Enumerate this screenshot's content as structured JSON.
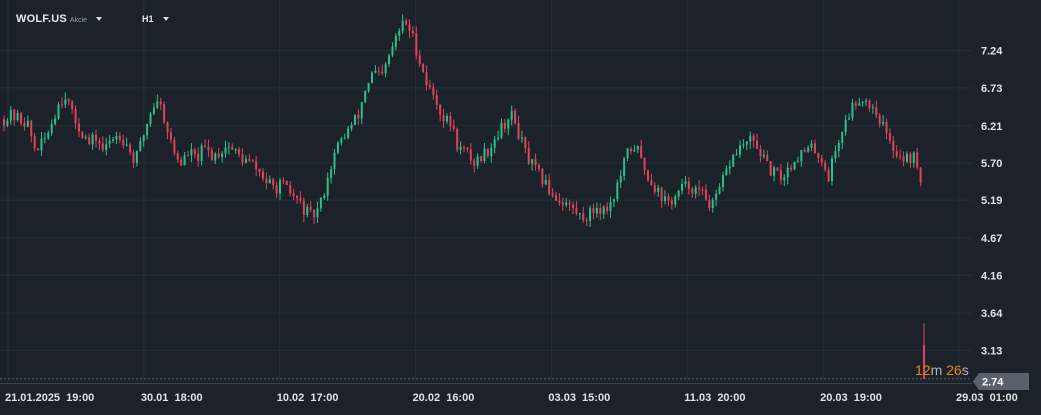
{
  "toolbar": {
    "symbol": "WOLF.US",
    "instrument_type": "Akcie",
    "timeframe": "H1"
  },
  "countdown": {
    "minutes": "12",
    "minutes_unit": "m",
    "seconds": "26",
    "seconds_unit": "s"
  },
  "current_price": "2.74",
  "colors": {
    "background": "#1b222a",
    "grid": "#262e38",
    "up": "#2ec08a",
    "down": "#e0435a",
    "axis_text": "#dfe3e8",
    "badge": "#59626c",
    "countdown": "#e08a1e"
  },
  "chart_data": {
    "type": "candlestick",
    "title": "",
    "xlabel": "",
    "ylabel": "",
    "ylim": [
      2.6,
      7.88
    ],
    "y_ticks": [
      "7.24",
      "6.73",
      "6.21",
      "5.70",
      "5.19",
      "4.67",
      "4.16",
      "3.64",
      "3.13"
    ],
    "x_tick_labels": [
      "21.01.2025  19:00",
      "30.01  18:00",
      "10.02  17:00",
      "20.02  16:00",
      "03.03  15:00",
      "11.03  20:00",
      "20.03  19:00",
      "29.03  01:00"
    ],
    "close_path": [
      6.3,
      6.35,
      6.3,
      6.25,
      5.9,
      5.95,
      6.2,
      6.5,
      6.65,
      6.3,
      6.15,
      5.95,
      6.05,
      5.85,
      6.05,
      6.1,
      5.95,
      5.7,
      6.05,
      6.4,
      6.6,
      6.25,
      5.85,
      5.7,
      5.85,
      5.75,
      5.9,
      5.8,
      5.85,
      5.95,
      5.85,
      5.75,
      5.7,
      5.6,
      5.45,
      5.35,
      5.4,
      5.3,
      5.2,
      5.05,
      4.95,
      5.1,
      5.5,
      5.85,
      6.05,
      6.2,
      6.35,
      6.75,
      6.95,
      6.85,
      7.15,
      7.45,
      7.65,
      7.45,
      7.1,
      6.75,
      6.6,
      6.3,
      6.25,
      5.9,
      5.85,
      5.7,
      5.8,
      5.9,
      6.1,
      6.25,
      6.35,
      6.05,
      5.75,
      5.6,
      5.45,
      5.3,
      5.2,
      5.15,
      5.05,
      4.95,
      5.0,
      5.1,
      5.05,
      5.2,
      5.5,
      5.85,
      5.95,
      5.65,
      5.45,
      5.3,
      5.15,
      5.2,
      5.35,
      5.4,
      5.3,
      5.25,
      5.1,
      5.35,
      5.65,
      5.85,
      5.95,
      6.0,
      5.9,
      5.65,
      5.55,
      5.5,
      5.65,
      5.8,
      5.85,
      5.9,
      5.8,
      5.5,
      5.9,
      6.2,
      6.45,
      6.6,
      6.55,
      6.45,
      6.25,
      5.95,
      5.85,
      5.75,
      5.8,
      5.5
    ],
    "last_candle": {
      "open": 3.2,
      "high": 3.5,
      "low": 2.74,
      "close": 2.74
    },
    "current_price": 2.74,
    "grid": true
  }
}
